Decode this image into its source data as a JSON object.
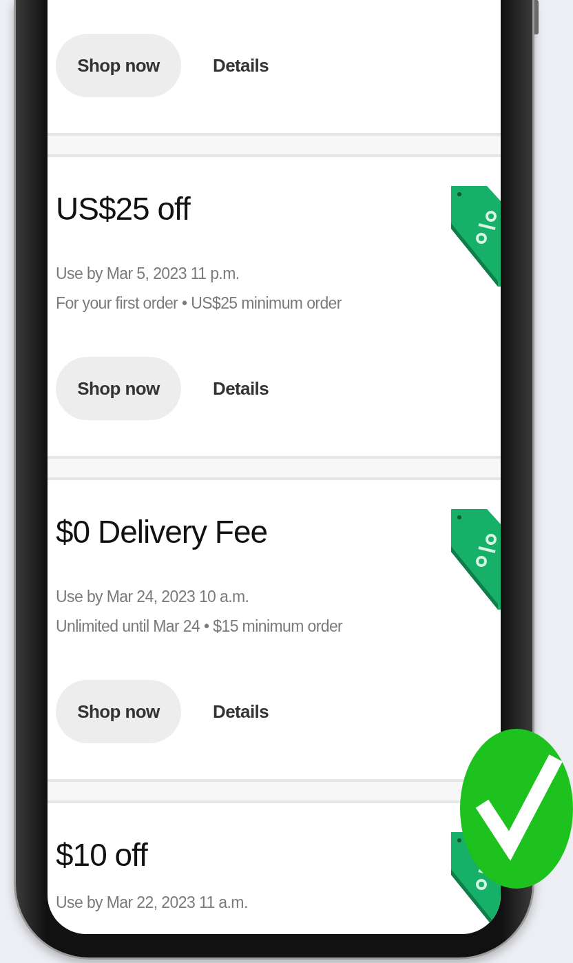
{
  "offers": [
    {
      "buttons": [
        "Shop now",
        "Details"
      ]
    },
    {
      "title": "US$25 off",
      "lines": [
        "Use by Mar 5, 2023 11 p.m.",
        "For your first order • US$25 minimum order"
      ],
      "buttons": [
        "Shop now",
        "Details"
      ]
    },
    {
      "title": "$0 Delivery Fee",
      "lines": [
        "Use by Mar 24, 2023 10 a.m.",
        "Unlimited until Mar 24 • $15 minimum order"
      ],
      "buttons": [
        "Shop now",
        "Details"
      ]
    },
    {
      "title": "$10 off",
      "lines": [
        "Use by Mar 22, 2023 11 a.m."
      ]
    }
  ]
}
